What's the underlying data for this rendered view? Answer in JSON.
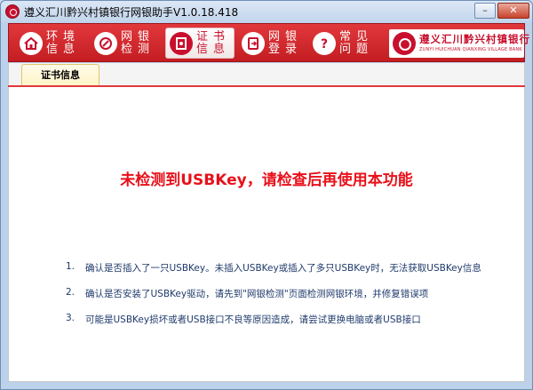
{
  "window": {
    "title": "遵义汇川黔兴村镇银行网银助手V1.0.18.418",
    "minimize_symbol": "–",
    "close_symbol": "✕"
  },
  "nav": {
    "items": [
      {
        "line1": "环境",
        "line2": "信息",
        "icon": "home-icon"
      },
      {
        "line1": "网银",
        "line2": "检测",
        "icon": "wrench-icon"
      },
      {
        "line1": "证书",
        "line2": "信息",
        "icon": "certificate-icon"
      },
      {
        "line1": "网银",
        "line2": "登录",
        "icon": "login-icon"
      },
      {
        "line1": "常见",
        "line2": "问题",
        "icon": "question-icon"
      }
    ],
    "active_index": 2
  },
  "logo": {
    "name_cn": "遵义汇川黔兴村镇银行",
    "name_en": "ZUNYI HUICHUAN QIANXING VILLAGE BANK"
  },
  "tabs": [
    {
      "label": "证书信息"
    }
  ],
  "content": {
    "error_message": "未检测到USBKey，请检查后再使用本功能",
    "tips": [
      {
        "num": "1.",
        "text": "确认是否插入了一只USBKey。未插入USBKey或插入了多只USBKey时，无法获取USBKey信息"
      },
      {
        "num": "2.",
        "text": "确认是否安装了USBKey驱动，请先到\"网银检测\"页面检测网银环境，并修复错误项"
      },
      {
        "num": "3.",
        "text": "可能是USBKey损坏或者USB接口不良等原因造成，请尝试更换电脑或者USB接口"
      }
    ]
  },
  "colors": {
    "brand_red": "#c8102e",
    "error_red": "#e8101a",
    "tip_text": "#1f3a6b"
  }
}
